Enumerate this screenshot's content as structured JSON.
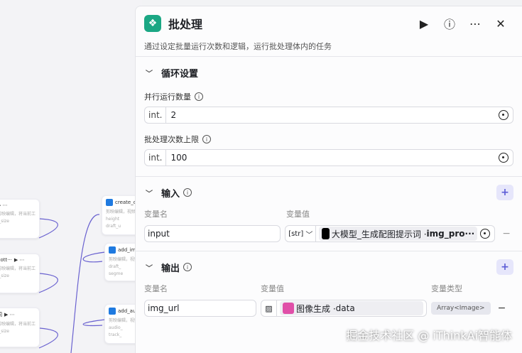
{
  "canvas": {
    "nodes": [
      {
        "title": "",
        "desc": "剪映编辑，将当前工作流的输出",
        "port": "t_size"
      },
      {
        "title": "bott···",
        "desc": "剪映编辑，将当前工作流的输出",
        "port": "t_size"
      },
      {
        "title": "词",
        "desc": "剪映编辑，将当前工作流的输出",
        "port": "t_size"
      },
      {
        "title": "create_d",
        "desc": "剪映编辑，视频生成",
        "in": "height",
        "out": "draft_u"
      },
      {
        "title": "add_im",
        "desc": "剪映编辑，视频生成",
        "in": "draft_",
        "out": "segme"
      },
      {
        "title": "add_au",
        "desc": "剪映编辑，视频生成",
        "in": "audio_",
        "out": "track_"
      }
    ]
  },
  "panel": {
    "title": "批处理",
    "description": "通过设定批量运行次数和逻辑，运行批处理体内的任务",
    "loop": {
      "heading": "循环设置",
      "parallel_label": "并行运行数量",
      "parallel_type": "int.",
      "parallel_value": "2",
      "limit_label": "批处理次数上限",
      "limit_type": "int.",
      "limit_value": "100"
    },
    "input": {
      "heading": "输入",
      "col_name": "变量名",
      "col_value": "变量值",
      "name": "input",
      "type": "[str]",
      "source": "大模型_生成配图提示词 · ",
      "field": "img_pro···"
    },
    "output": {
      "heading": "输出",
      "col_name": "变量名",
      "col_value": "变量值",
      "col_type": "变量类型",
      "name": "img_url",
      "source": "图像生成 · ",
      "field": "data",
      "type": "Array<Image>"
    }
  },
  "watermark": "掘金技术社区 @ iThinkAi智能体",
  "colors": {
    "accent": "#5b5bd6",
    "logo": "#1ba784"
  }
}
